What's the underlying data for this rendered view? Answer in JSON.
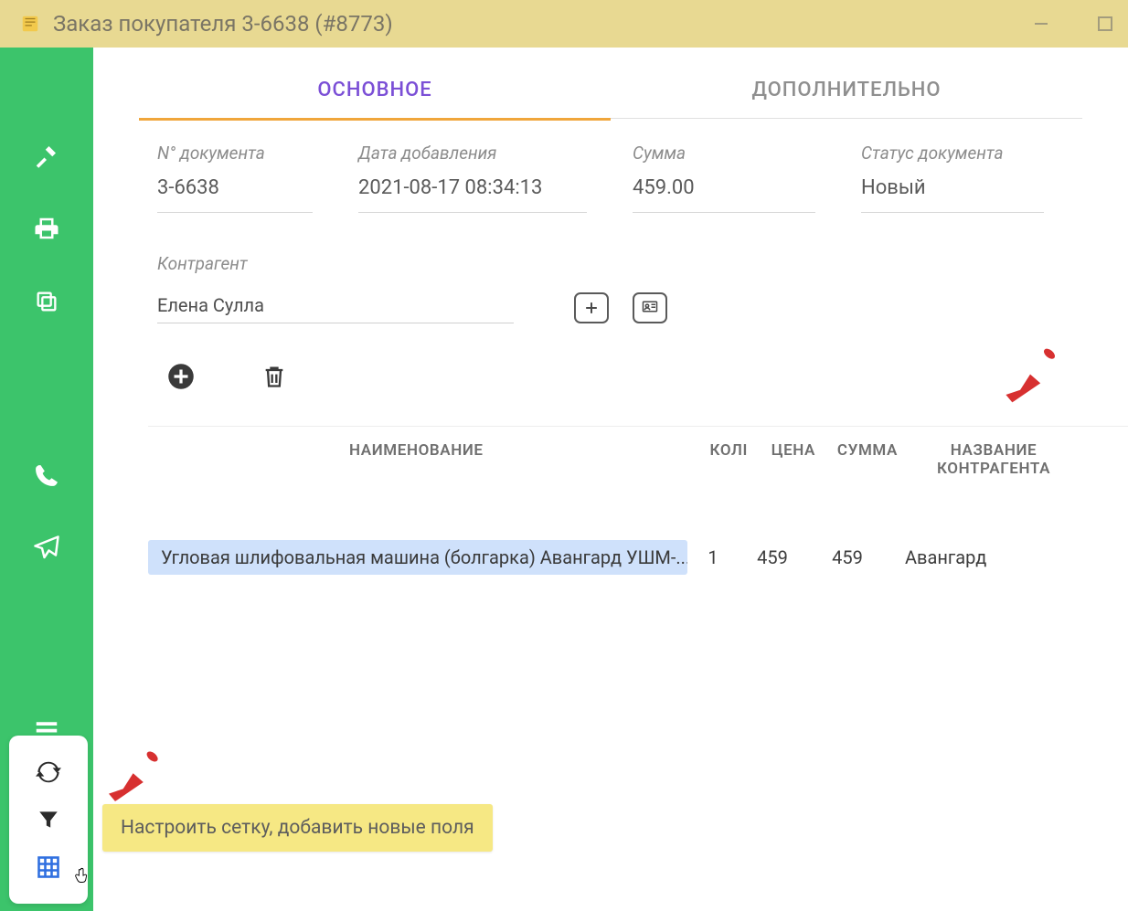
{
  "window": {
    "title": "Заказ покупателя 3-6638 (#8773)"
  },
  "tabs": {
    "main": "ОСНОВНОЕ",
    "extra": "ДОПОЛНИТЕЛЬНО"
  },
  "info": {
    "doc_no_label": "N° документа",
    "doc_no_value": "3-6638",
    "date_label": "Дата добавления",
    "date_value": "2021-08-17 08:34:13",
    "sum_label": "Сумма",
    "sum_value": "459.00",
    "status_label": "Статус документа",
    "status_value": "Новый"
  },
  "contragent": {
    "label": "Контрагент",
    "value": "Елена Сулла"
  },
  "table": {
    "headers": {
      "name": "НАИМЕНОВАНИЕ",
      "qty": "КОЛІ",
      "price": "ЦЕНА",
      "sum": "СУММА",
      "contragent": "НАЗВАНИЕ КОНТРАГЕНТА"
    },
    "rows": [
      {
        "name": "Угловая шлифовальная машина (болгарка) Авангард УШМ-...",
        "qty": "1",
        "price": "459",
        "sum": "459",
        "contragent": "Авангард"
      }
    ]
  },
  "tooltip": {
    "text": "Настроить сетку, добавить новые поля"
  }
}
